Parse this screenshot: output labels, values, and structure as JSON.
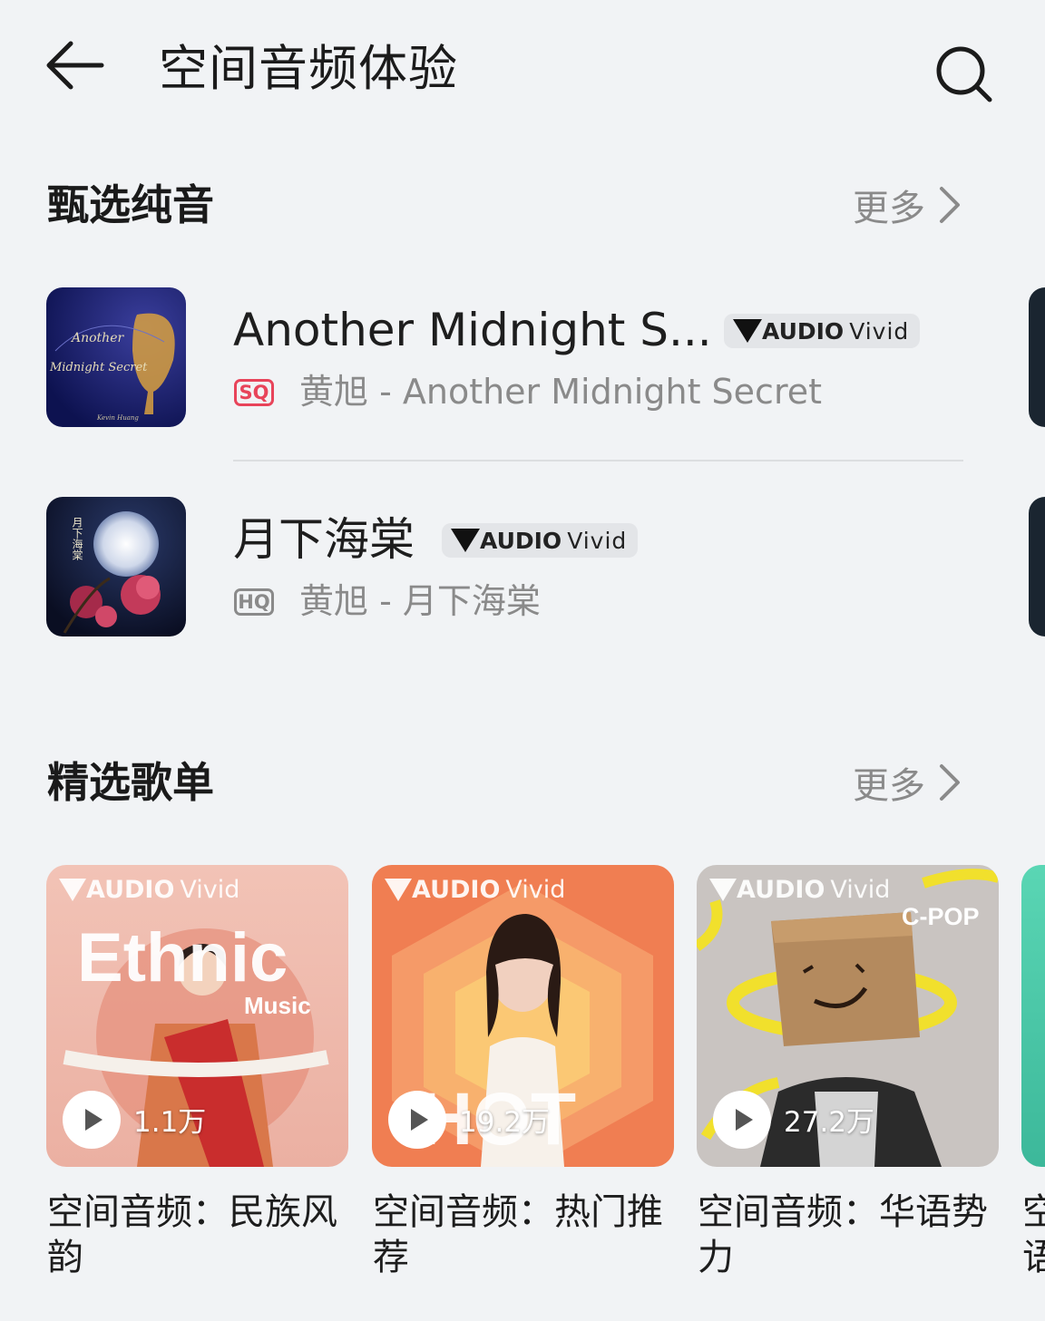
{
  "header": {
    "title": "空间音频体验"
  },
  "pure_section": {
    "title": "甄选纯音",
    "more": "更多",
    "tracks": [
      {
        "title": "Another Midnight S...",
        "badge_brand": "AUDIO",
        "badge_word": "Vivid",
        "quality": "SQ",
        "subtitle": "黄旭 - Another Midnight Secret",
        "cover_text_1": "Another",
        "cover_text_2": "Midnight Secret",
        "cover_text_3": "Kevin Huang"
      },
      {
        "title": "月下海棠",
        "badge_brand": "AUDIO",
        "badge_word": "Vivid",
        "quality": "HQ",
        "subtitle": "黄旭 - 月下海棠",
        "cover_text_1": "月下海棠"
      }
    ]
  },
  "playlist_section": {
    "title": "精选歌单",
    "more": "更多",
    "playlists": [
      {
        "brand": "AUDIO",
        "brand_word": "Vivid",
        "cover_text_big": "Ethnic",
        "cover_text_small": "Music",
        "play_count": "1.1万",
        "title": "空间音频：民族风韵"
      },
      {
        "brand": "AUDIO",
        "brand_word": "Vivid",
        "cover_text_big": "HOT",
        "play_count": "19.2万",
        "title": "空间音频：热门推荐"
      },
      {
        "brand": "AUDIO",
        "brand_word": "Vivid",
        "cover_text_small": "C-POP",
        "play_count": "27.2万",
        "title": "空间音频：华语势力"
      },
      {
        "title": "空语"
      }
    ]
  },
  "colors": {
    "background": "#f1f3f5",
    "sq_red": "#e8445a",
    "muted_gray": "#8a8a8a"
  }
}
